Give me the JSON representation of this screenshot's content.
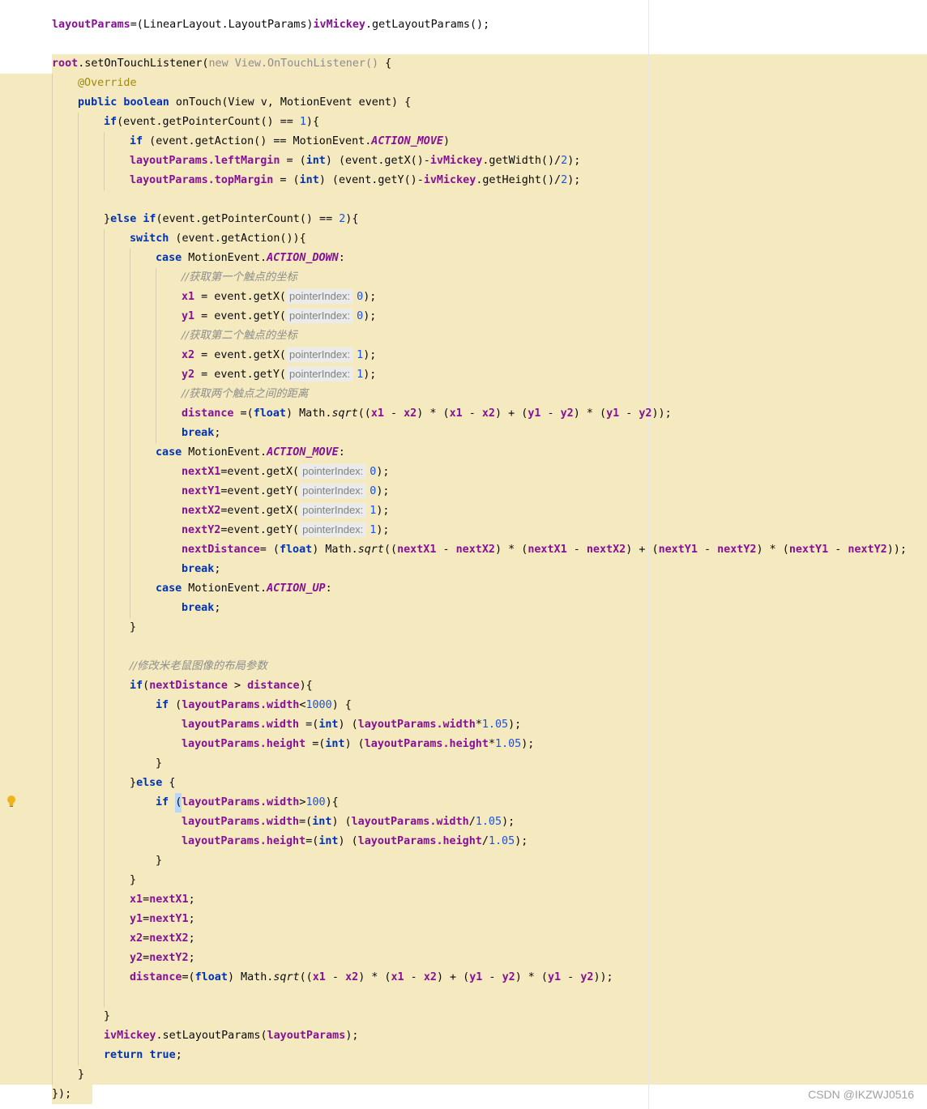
{
  "editor": {
    "colors": {
      "background": "#ffffff",
      "highlight": "#f5eabf",
      "keyword": "#0033b3",
      "field": "#871094",
      "number": "#1750eb",
      "annotation": "#9e880d",
      "comment": "#8c8c8c"
    },
    "gutter_icon": "lightbulb-icon",
    "hints": {
      "pointer_index": "pointerIndex:"
    },
    "numbers": {
      "zero": "0",
      "one": "1",
      "two": "2",
      "thousand": "1000",
      "hundred": "100",
      "factor": "1.05"
    },
    "comments": {
      "first_point": "//获取第一个触点的坐标",
      "second_point": "//获取第二个触点的坐标",
      "distance": "//获取两个触点之间的距离",
      "modify": "//修改米老鼠图像的布局参数"
    },
    "lines": {
      "l1_a": "layoutParams",
      "l1_b": "=(LinearLayout.LayoutParams)",
      "l1_c": "ivMickey",
      "l1_d": ".getLayoutParams();",
      "l2_root": "root",
      "l2_a": ".setOnTouchListener(",
      "l2_new": "new",
      "l2_b": " View.OnTouchListener()",
      "l2_c": " {",
      "l3": "@Override",
      "l4_kw": "public boolean",
      "l4_rest": " onTouch(View v, MotionEvent event) {",
      "l5_kw": "if",
      "l5_a": "(event.getPointerCount() == ",
      "l5_b": "){",
      "l6_kw": "if",
      "l6_a": " (event.getAction() == MotionEvent.",
      "l6_b": "ACTION_MOVE",
      "l6_c": ")",
      "l7_f1": "layoutParams",
      "l7_f2": ".leftMargin",
      "l7_a": " = (",
      "l7_int": "int",
      "l7_b": ") (event.getX()-",
      "l7_f3": "ivMickey",
      "l7_c": ".getWidth()/",
      "l7_d": ");",
      "l8_f2": ".topMargin",
      "l8_b": ") (event.getY()-",
      "l8_c": ".getHeight()/",
      "l9_a": "}",
      "l9_else": "else if",
      "l9_b": "(event.getPointerCount() == ",
      "l9_c": "){",
      "l10_kw": "switch",
      "l10_rest": " (event.getAction()){",
      "case": "case",
      "me": " MotionEvent.",
      "down": "ACTION_DOWN",
      "move": "ACTION_MOVE",
      "up": "ACTION_UP",
      "colon": ":",
      "x1": "x1",
      "y1": "y1",
      "x2": "x2",
      "y2": "y2",
      "eq_getx": " = event.getX(",
      "eq_gety": " = event.getY(",
      "close": ");",
      "distance": "distance",
      "dist_a": " =(",
      "float": "float",
      "dist_b": ") Math.",
      "sqrt": "sqrt",
      "dist_c": "((",
      "minus": " - ",
      "times_open": ") * (",
      "plus_open": ") + (",
      "end2": "));",
      "brk": "break",
      "semi": ";",
      "nx1": "nextX1",
      "ny1": "nextY1",
      "nx2": "nextX2",
      "ny2": "nextY2",
      "ngetx": "=event.getX(",
      "ngety": "=event.getY(",
      "ndist": "nextDistance",
      "ndist_a": "= (",
      "rbrace": "}",
      "if_kw": "if",
      "if_a": "(",
      "gt": " > ",
      "if_b": "){",
      "if_sp": " (",
      "lp": "layoutParams",
      "width": ".width",
      "height": ".height",
      "lt": "<",
      "gtc": ">",
      "brace_open": ") {",
      "eq_int_a": " =(",
      "int": "int",
      "paren_sp": ") (",
      "mul": "*",
      "div": "/",
      "end1": ");",
      "else_a": "}",
      "else_kw": "else",
      "else_b": " {",
      "caret_paren": "(",
      "brace_only": "){",
      "eq_int_b": "=(",
      "x1_eq": "=",
      "dist_eq": "=(",
      "set_a": ".setLayoutParams(",
      "ret": "return",
      "tru": "true",
      "final": "});"
    }
  },
  "watermark": "CSDN @IKZWJ0516"
}
